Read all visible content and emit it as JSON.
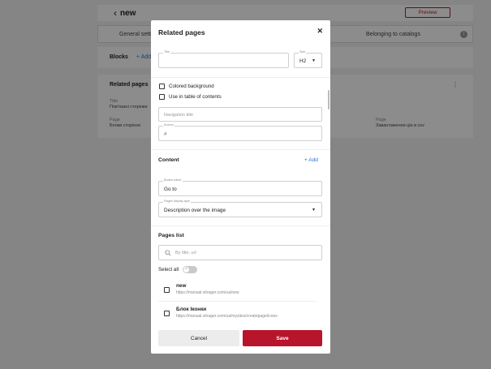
{
  "background": {
    "header_title": "new",
    "preview_label": "Preview",
    "tabs": [
      "General setti",
      "Belonging to catalogs"
    ],
    "blocks_label": "Blocks",
    "blocks_add": "+ Add",
    "card": {
      "title": "Related pages",
      "title_label": "Title",
      "title_value": "Пов'язані сторінки",
      "page_label_1": "Page",
      "page_value_1": "Блоки сторінок",
      "page_label_2": "Page",
      "page_value_2": "Завантаження цін в csv"
    }
  },
  "modal": {
    "title": "Related pages",
    "close_glyph": "✕",
    "title_field": {
      "label": "Title",
      "value": ""
    },
    "size_field": {
      "label": "Size",
      "value": "H2"
    },
    "colored_background": "Colored background",
    "use_in_toc": "Use in table of contents",
    "navigation_title_placeholder": "Navigation title",
    "anchor_field": {
      "label": "Anchor",
      "value": "#"
    },
    "content_title": "Content",
    "content_add": "+ Add",
    "button_name_field": {
      "label": "Button name",
      "value": "Go to"
    },
    "display_type_field": {
      "label": "Pages display type",
      "value": "Description over the image"
    },
    "pages_list_title": "Pages list",
    "search_placeholder": "By title, url",
    "select_all_label": "Select all",
    "pages": [
      {
        "title": "new",
        "url": "https://manual.vitrager.com/ua/new"
      },
      {
        "title": "Блок Іконки",
        "url": "https://manual.vitrager.com/ua/mysites/createpage/icons"
      }
    ],
    "cancel_label": "Cancel",
    "save_label": "Save"
  },
  "colors": {
    "accent": "#b8142b",
    "link": "#2b6fd6"
  }
}
